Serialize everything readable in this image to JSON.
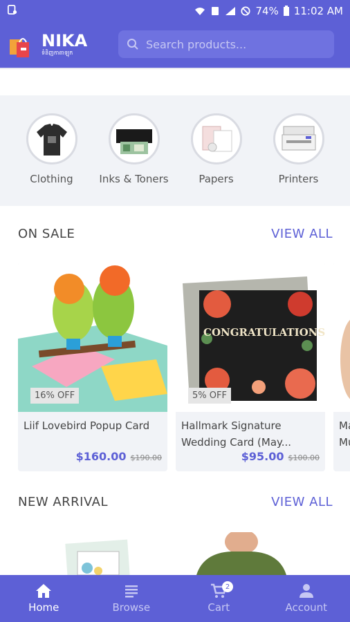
{
  "status_bar": {
    "battery": "74%",
    "time": "11:02 AM"
  },
  "header": {
    "logo_text": "NIKA",
    "logo_subtitle": "ទំនិញកាតាឡុក",
    "search_placeholder": "Search products..."
  },
  "categories": [
    {
      "label": "Clothing",
      "icon": "tshirt-icon"
    },
    {
      "label": "Inks & Toners",
      "icon": "printer-ink-icon"
    },
    {
      "label": "Papers",
      "icon": "paper-icon"
    },
    {
      "label": "Printers",
      "icon": "printer-icon"
    }
  ],
  "on_sale": {
    "title": "ON SALE",
    "view_all": "VIEW ALL",
    "products": [
      {
        "name": "Liif Lovebird Popup Card",
        "discount": "16% OFF",
        "price": "$160.00",
        "old_price": "$190.00"
      },
      {
        "name": "Hallmark Signature Wedding Card (May...",
        "discount": "5% OFF",
        "price": "$95.00",
        "old_price": "$100.00",
        "card_text": "CONGRATULATIONS"
      },
      {
        "name": "Ma Mu",
        "discount": "",
        "price": "",
        "old_price": ""
      }
    ]
  },
  "new_arrival": {
    "title": "NEW ARRIVAL",
    "view_all": "VIEW ALL"
  },
  "bottom_nav": [
    {
      "label": "Home",
      "icon": "home-icon",
      "active": true
    },
    {
      "label": "Browse",
      "icon": "list-icon",
      "active": false
    },
    {
      "label": "Cart",
      "icon": "cart-icon",
      "active": false,
      "badge": "2"
    },
    {
      "label": "Account",
      "icon": "person-icon",
      "active": false
    }
  ],
  "colors": {
    "primary": "#5d60d6",
    "background_light": "#f1f3f7"
  }
}
